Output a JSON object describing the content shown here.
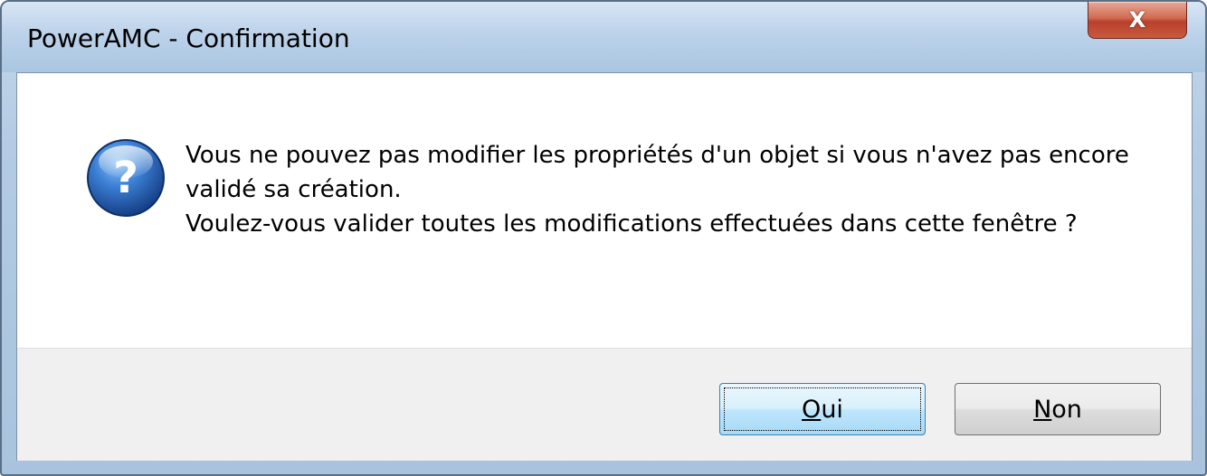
{
  "window": {
    "title": "PowerAMC - Confirmation",
    "close_label": "X"
  },
  "icon": "question-icon",
  "message": {
    "line1": "Vous ne pouvez pas modifier les propriétés d'un objet si vous n'avez pas encore validé sa création.",
    "line2": "Voulez-vous valider toutes les modifications effectuées dans cette fenêtre ?"
  },
  "buttons": {
    "yes_mnemonic": "O",
    "yes_rest": "ui",
    "no_mnemonic": "N",
    "no_rest": "on"
  },
  "colors": {
    "accent": "#3c7fb1",
    "close": "#c95a3f",
    "icon_blue": "#2a66b8"
  }
}
